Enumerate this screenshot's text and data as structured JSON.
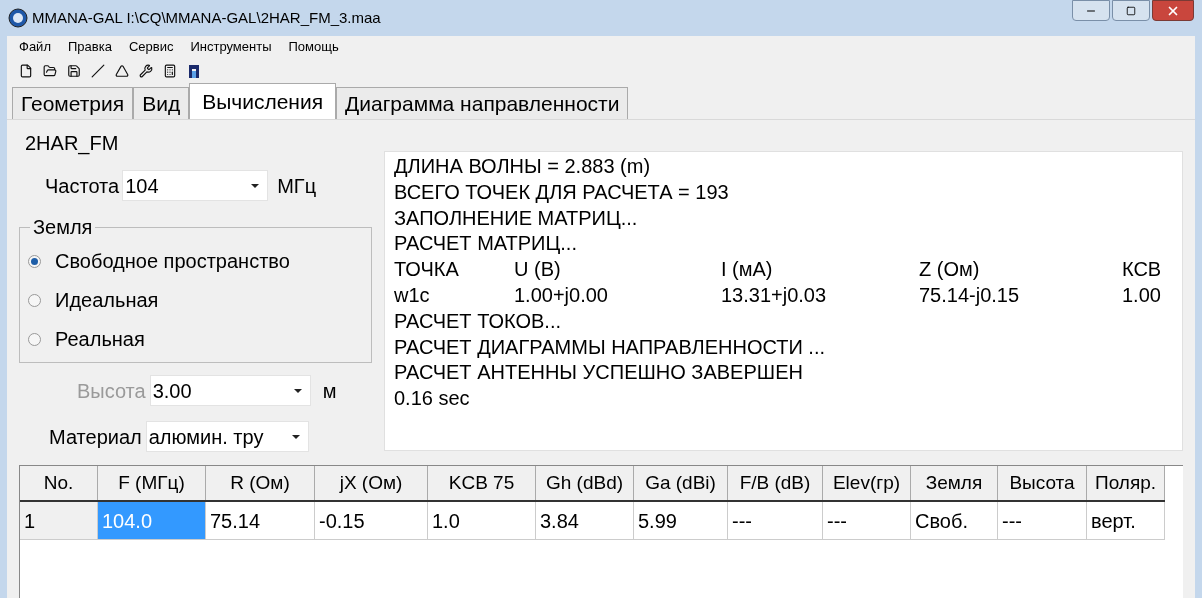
{
  "window": {
    "title": "MMANA-GAL I:\\CQ\\MMANA-GAL\\2HAR_FM_3.maa"
  },
  "menu": [
    "Файл",
    "Правка",
    "Сервис",
    "Инструменты",
    "Помощь"
  ],
  "tabs": [
    {
      "label": "Геометрия",
      "selected": false
    },
    {
      "label": "Вид",
      "selected": false
    },
    {
      "label": "Вычисления",
      "selected": true
    },
    {
      "label": "Диаграмма направленности",
      "selected": false
    }
  ],
  "project_name": "2HAR_FM",
  "frequency": {
    "label": "Частота",
    "value": "104",
    "unit": "МГц"
  },
  "ground": {
    "title": "Земля",
    "options": [
      {
        "label": "Свободное пространство",
        "selected": true
      },
      {
        "label": "Идеальная",
        "selected": false
      },
      {
        "label": "Реальная",
        "selected": false
      }
    ]
  },
  "height": {
    "label": "Высота",
    "value": "3.00",
    "unit": "м",
    "disabled": true
  },
  "material": {
    "label": "Материал",
    "value": "алюмин. тру"
  },
  "output": [
    {
      "kind": "text",
      "text": "ДЛИНА ВОЛНЫ = 2.883 (m)"
    },
    {
      "kind": "text",
      "text": "ВСЕГО ТОЧЕК ДЛЯ РАСЧЕТА = 193"
    },
    {
      "kind": "text",
      "text": "ЗАПОЛНЕНИЕ МАТРИЦ..."
    },
    {
      "kind": "text",
      "text": "РАСЧЕТ МАТРИЦ..."
    },
    {
      "kind": "columns",
      "cells": [
        "ТОЧКА",
        "U (B)",
        "I (мА)",
        "Z (Ом)",
        "КСВ"
      ]
    },
    {
      "kind": "columns",
      "cells": [
        "w1c",
        "1.00+j0.00",
        "13.31+j0.03",
        "75.14-j0.15",
        "1.00"
      ]
    },
    {
      "kind": "text",
      "text": "РАСЧЕТ ТОКОВ..."
    },
    {
      "kind": "text",
      "text": "РАСЧЕТ ДИАГРАММЫ НАПРАВЛЕННОСТИ ..."
    },
    {
      "kind": "text",
      "text": "РАСЧЕТ АНТЕННЫ УСПЕШНО ЗАВЕРШЕН"
    },
    {
      "kind": "text",
      "text": "0.16 sec"
    }
  ],
  "table": {
    "columns": [
      "No.",
      "F (МГц)",
      "R (Ом)",
      "jX (Ом)",
      "KCB 75",
      "Gh (dBd)",
      "Ga (dBi)",
      "F/B (dB)",
      "Elev(гр)",
      "Земля",
      "Высота",
      "Поляр."
    ],
    "rows": [
      {
        "cells": [
          {
            "text": "1",
            "selected": false
          },
          {
            "text": "104.0",
            "selected": true
          },
          {
            "text": "75.14",
            "selected": false
          },
          {
            "text": "-0.15",
            "selected": false
          },
          {
            "text": "1.0",
            "selected": false
          },
          {
            "text": "3.84",
            "selected": false
          },
          {
            "text": "5.99",
            "selected": false
          },
          {
            "text": "---",
            "selected": false
          },
          {
            "text": "---",
            "selected": false
          },
          {
            "text": "Своб.",
            "selected": false
          },
          {
            "text": "---",
            "selected": false
          },
          {
            "text": "верт.",
            "selected": false
          }
        ]
      }
    ]
  }
}
